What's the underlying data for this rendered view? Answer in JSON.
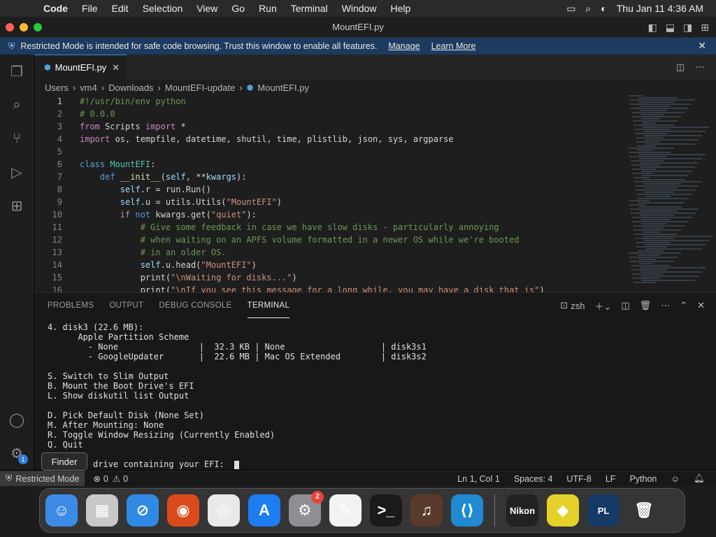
{
  "menubar": {
    "app_name": "Code",
    "items": [
      "File",
      "Edit",
      "Selection",
      "View",
      "Go",
      "Run",
      "Terminal",
      "Window",
      "Help"
    ],
    "clock": "Thu Jan 11  4:36 AM"
  },
  "window": {
    "title": "MountEFI.py"
  },
  "banner": {
    "message": "Restricted Mode is intended for safe code browsing. Trust this window to enable all features.",
    "manage": "Manage",
    "learn_more": "Learn More"
  },
  "tab": {
    "label": "MountEFI.py"
  },
  "breadcrumb": [
    "Users",
    "vm4",
    "Downloads",
    "MountEFI-update",
    "MountEFI.py"
  ],
  "code_lines": [
    {
      "n": "1",
      "html": "<span class='cm'>#!/usr/bin/env python</span>"
    },
    {
      "n": "2",
      "html": "<span class='cm'># 0.0.0</span>"
    },
    {
      "n": "3",
      "html": "<span class='kw'>from</span> Scripts <span class='kw'>import</span> *"
    },
    {
      "n": "4",
      "html": "<span class='kw'>import</span> os, tempfile, datetime, shutil, time, plistlib, json, sys, argparse"
    },
    {
      "n": "5",
      "html": ""
    },
    {
      "n": "6",
      "html": "<span class='kw2'>class</span> <span class='cls'>MountEFI</span>:"
    },
    {
      "n": "7",
      "html": "    <span class='kw2'>def</span> <span class='fn'>__init__</span>(<span class='var'>self</span>, **<span class='var'>kwargs</span>):"
    },
    {
      "n": "8",
      "html": "        <span class='var'>self</span>.r = run.Run()"
    },
    {
      "n": "9",
      "html": "        <span class='var'>self</span>.u = utils.Utils(<span class='str'>\"MountEFI\"</span>)"
    },
    {
      "n": "10",
      "html": "        <span class='kw'>if</span> <span class='kw2'>not</span> kwargs.get(<span class='str'>\"quiet\"</span>):"
    },
    {
      "n": "11",
      "html": "            <span class='cm'># Give some feedback in case we have slow disks - particularly annoying</span>"
    },
    {
      "n": "12",
      "html": "            <span class='cm'># when waiting on an APFS volume formatted in a newer OS while we're booted</span>"
    },
    {
      "n": "13",
      "html": "            <span class='cm'># in an older OS.</span>"
    },
    {
      "n": "14",
      "html": "            <span class='var'>self</span>.u.head(<span class='str'>\"MountEFI\"</span>)"
    },
    {
      "n": "15",
      "html": "            print(<span class='str'>\"\\nWaiting for disks...\"</span>)"
    },
    {
      "n": "16",
      "html": "            print(<span class='str'>\"\\nIf you see this message for a long while, you may have a disk that is\"</span>)"
    }
  ],
  "panel": {
    "tabs": [
      "PROBLEMS",
      "OUTPUT",
      "DEBUG CONSOLE",
      "TERMINAL"
    ],
    "shell": "zsh"
  },
  "terminal_lines": [
    "4. disk3 (22.6 MB):",
    "      Apple Partition Scheme",
    "        - None                |  32.3 KB | None                   | disk3s1",
    "        - GoogleUpdater       |  22.6 MB | Mac OS Extended        | disk3s2",
    "",
    "S. Switch to Slim Output",
    "B. Mount the Boot Drive's EFI",
    "L. Show diskutil list Output",
    "",
    "D. Pick Default Disk (None Set)",
    "M. After Mounting: None",
    "R. Toggle Window Resizing (Currently Enabled)",
    "Q. Quit",
    ""
  ],
  "terminal_prompt": "Pick the drive containing your EFI:  ",
  "tooltip": "Finder",
  "statusbar": {
    "restricted": "Restricted Mode",
    "errors": "0",
    "warnings": "0",
    "position": "Ln 1, Col 1",
    "spaces": "Spaces: 4",
    "encoding": "UTF-8",
    "eol": "LF",
    "language": "Python"
  },
  "accounts_badge": "1",
  "dock": {
    "apps": [
      {
        "name": "finder",
        "glyph": "☺",
        "bg": "#3c8ce7"
      },
      {
        "name": "launchpad",
        "glyph": "▦",
        "bg": "#c8c8c8"
      },
      {
        "name": "safari",
        "glyph": "⊘",
        "bg": "#2f8ae6"
      },
      {
        "name": "firefox",
        "glyph": "◉",
        "bg": "#d94b1b"
      },
      {
        "name": "chrome",
        "glyph": "◎",
        "bg": "#e9e9e9"
      },
      {
        "name": "app-store",
        "glyph": "A",
        "bg": "#1d7cf2"
      },
      {
        "name": "system-settings",
        "glyph": "⚙",
        "bg": "#8e8e93",
        "badge": "2"
      },
      {
        "name": "textedit",
        "glyph": "✎",
        "bg": "#f2f2f2"
      },
      {
        "name": "terminal",
        "glyph": ">_",
        "bg": "#1a1a1a"
      },
      {
        "name": "garageband",
        "glyph": "♫",
        "bg": "#5a3a2a"
      },
      {
        "name": "vscode",
        "glyph": "⟨⟩",
        "bg": "#1f8ad2"
      }
    ],
    "apps2": [
      {
        "name": "nikon",
        "glyph": "Nikon",
        "bg": "#222"
      },
      {
        "name": "sticky",
        "glyph": "◆",
        "bg": "#e4d22a"
      },
      {
        "name": "pl",
        "glyph": "PL",
        "bg": "#163a66"
      },
      {
        "name": "trash",
        "glyph": "🗑",
        "bg": "transparent"
      }
    ]
  }
}
